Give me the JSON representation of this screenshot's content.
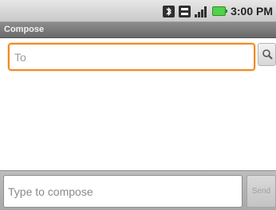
{
  "status_bar": {
    "time": "3:00 PM",
    "icons": [
      "bluetooth-icon",
      "data-activity-icon",
      "signal-strength-icon",
      "battery-icon"
    ],
    "battery_color": "#52d14a"
  },
  "title_bar": {
    "title": "Compose"
  },
  "recipient": {
    "placeholder": "To",
    "value": "",
    "focused": true,
    "focus_color": "#f08a20"
  },
  "search_button": {
    "icon": "magnifier-icon"
  },
  "compose": {
    "placeholder": "Type to compose",
    "value": ""
  },
  "send_button": {
    "label": "Send",
    "enabled": false
  }
}
